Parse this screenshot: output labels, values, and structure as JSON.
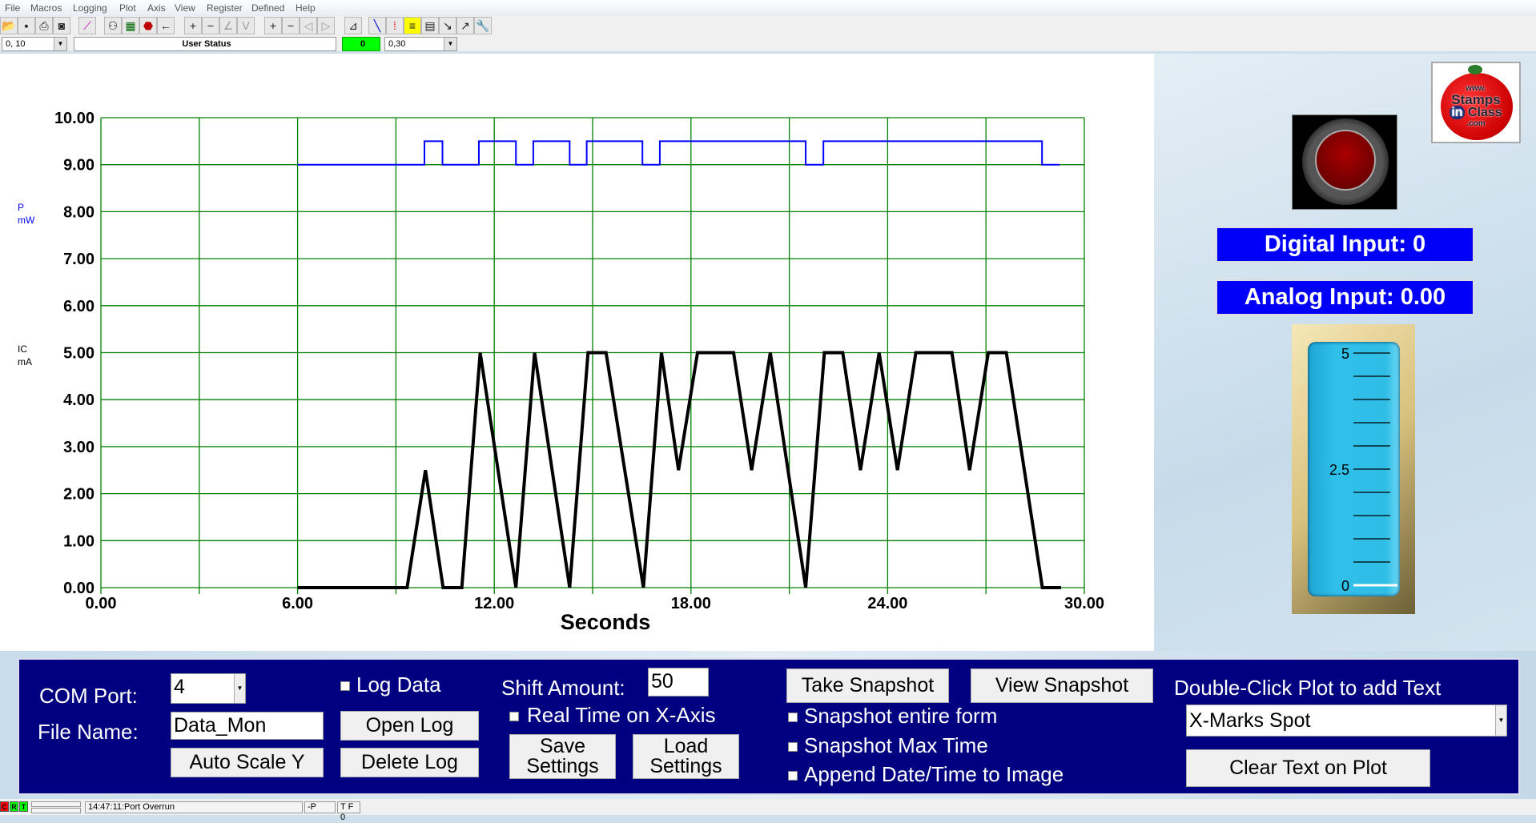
{
  "menu": [
    "File",
    "Macros",
    "Logging",
    "Plot",
    "Axis",
    "View",
    "Register",
    "Defined",
    "Help"
  ],
  "toolbar_icons": [
    "open-folder-icon",
    "save-disk-icon",
    "print-icon",
    "camera-icon",
    "wand-icon",
    "connect-icon",
    "grid-icon",
    "stop-icon",
    "arrow-left-icon",
    "plus-icon",
    "minus-icon",
    "zoom-y-in-icon",
    "zoom-y-out-icon",
    "plus-icon",
    "minus-icon",
    "zoom-x-in-icon",
    "zoom-x-out-icon",
    "chart-icon",
    "pen-icon",
    "markers-icon",
    "note-icon",
    "clipboard-icon",
    "probe-icon",
    "scale-icon",
    "wrench-icon"
  ],
  "combos": {
    "left_value": "0, 10",
    "user_status": "User Status",
    "indicator_value": "0",
    "indicator_color": "#00ff00",
    "right_value": "0,30"
  },
  "chart_data": {
    "type": "line",
    "xlabel": "Seconds",
    "xlim": [
      0,
      30
    ],
    "ylim": [
      0,
      10
    ],
    "xticks": [
      "0.00",
      "6.00",
      "12.00",
      "18.00",
      "24.00",
      "30.00"
    ],
    "yticks": [
      "0.00",
      "1.00",
      "2.00",
      "3.00",
      "4.00",
      "5.00",
      "6.00",
      "7.00",
      "8.00",
      "9.00",
      "10.00"
    ],
    "grid": true,
    "grid_color": "#008000",
    "axis_labels_left": [
      {
        "line1": "P",
        "line2": "mW",
        "color": "#0000ff"
      },
      {
        "line1": "IC",
        "line2": "mA",
        "color": "#000000"
      }
    ],
    "series": [
      {
        "name": "P mW",
        "color": "#0000ff",
        "x": [
          6.0,
          9.87,
          9.87,
          10.42,
          10.42,
          11.53,
          11.53,
          12.66,
          12.66,
          13.19,
          13.19,
          14.3,
          14.3,
          14.82,
          14.82,
          16.52,
          16.52,
          17.05,
          17.05,
          21.5,
          21.5,
          22.04,
          22.04,
          28.71,
          28.71,
          29.25
        ],
        "y": [
          9,
          9,
          9.5,
          9.5,
          9,
          9,
          9.5,
          9.5,
          9,
          9,
          9.5,
          9.5,
          9,
          9,
          9.5,
          9.5,
          9,
          9,
          9.5,
          9.5,
          9,
          9,
          9.5,
          9.5,
          9,
          9
        ]
      },
      {
        "name": "IC mA",
        "color": "#000000",
        "x": [
          6.0,
          9.34,
          9.9,
          10.44,
          11.01,
          11.57,
          12.66,
          13.23,
          14.3,
          14.86,
          15.41,
          16.55,
          17.1,
          17.62,
          18.2,
          19.3,
          19.85,
          20.42,
          21.5,
          22.07,
          22.63,
          23.17,
          23.74,
          24.3,
          24.86,
          25.96,
          26.5,
          27.07,
          27.62,
          28.72,
          29.29
        ],
        "y": [
          0,
          0,
          2.5,
          0,
          0,
          5,
          0,
          5,
          0,
          5,
          5,
          0,
          5,
          2.5,
          5,
          5,
          2.5,
          5,
          0,
          5,
          5,
          2.5,
          5,
          2.5,
          5,
          5,
          2.5,
          5,
          5,
          0,
          0
        ]
      }
    ]
  },
  "right_panel": {
    "logo_text": [
      "www.",
      "Stamps",
      "in Class",
      ".com"
    ],
    "digital_input": "Digital Input: 0",
    "analog_input": "Analog Input: 0.00",
    "gauge": {
      "min": 0,
      "max": 5,
      "value": 0,
      "labels": [
        "5",
        "2.5",
        "0"
      ]
    }
  },
  "bottom": {
    "com_port_label": "COM Port:",
    "com_port_value": "4",
    "file_name_label": "File Name:",
    "file_name_value": "Data_Mon",
    "auto_scale": "Auto Scale Y",
    "log_data": "Log Data",
    "open_log": "Open Log",
    "delete_log": "Delete Log",
    "shift_label": "Shift Amount:",
    "shift_value": "50",
    "real_time": "Real Time on X-Axis",
    "save_settings": [
      "Save",
      "Settings"
    ],
    "load_settings": [
      "Load",
      "Settings"
    ],
    "take_snapshot": "Take Snapshot",
    "view_snapshot": "View Snapshot",
    "snap_entire": "Snapshot entire form",
    "snap_max": "Snapshot Max Time",
    "append_date": "Append Date/Time to Image",
    "dbl_click_label": "Double-Click Plot to add Text",
    "text_select": "X-Marks Spot",
    "clear_text": "Clear Text on Plot"
  },
  "status": {
    "c": "C",
    "r": "R",
    "t": "T",
    "message": "14:47:11:Port Overrun",
    "p": "-P",
    "tf": "T F 0"
  }
}
